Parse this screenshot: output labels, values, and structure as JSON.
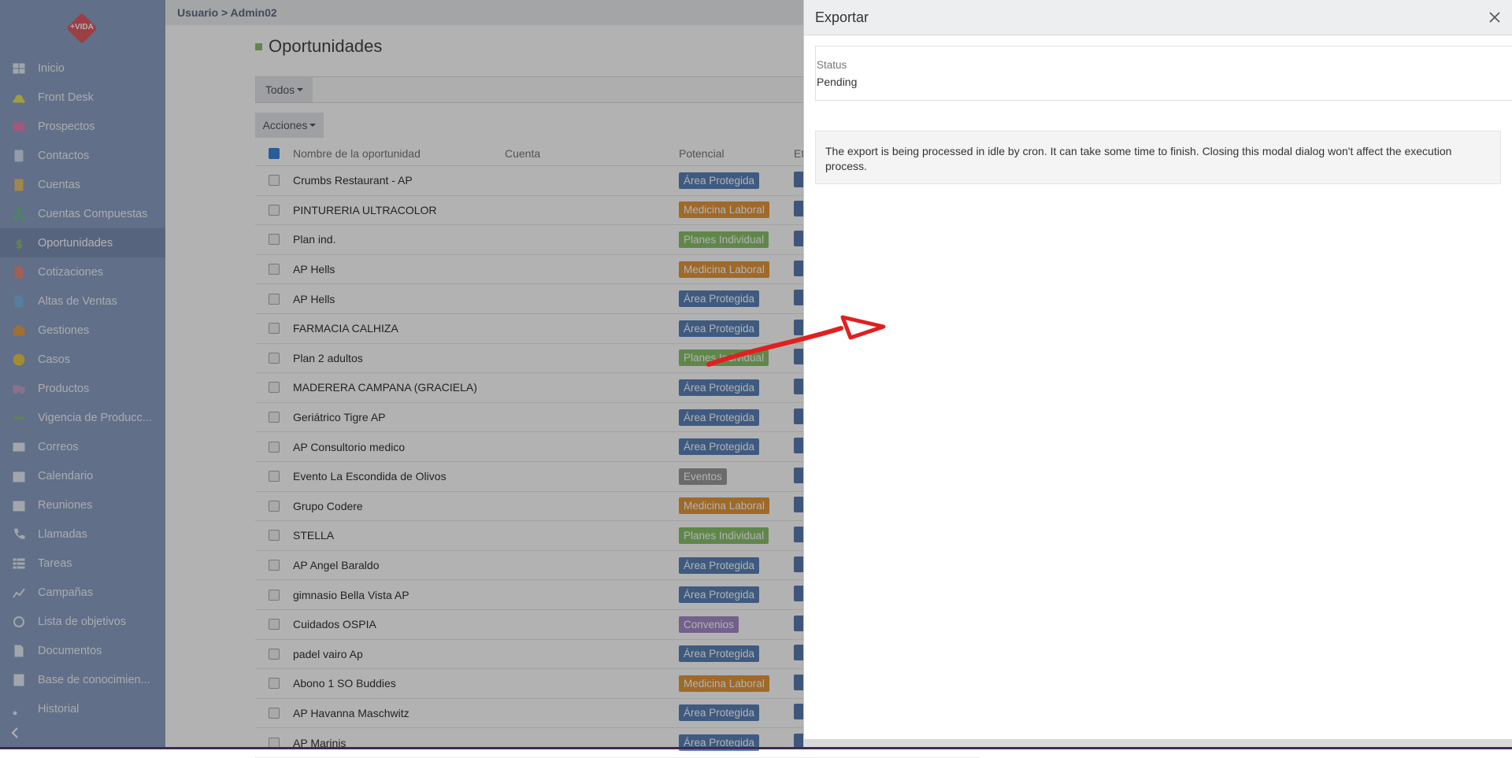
{
  "sidebar": {
    "logo_text": "+VIDA",
    "items": [
      {
        "label": "Inicio",
        "icon": "dashboard-icon",
        "color": "#e9eef7"
      },
      {
        "label": "Front Desk",
        "icon": "bell-icon",
        "color": "#e8e35a"
      },
      {
        "label": "Prospectos",
        "icon": "id-card-icon",
        "color": "#e87fb0"
      },
      {
        "label": "Contactos",
        "icon": "contact-icon",
        "color": "#d6def0"
      },
      {
        "label": "Cuentas",
        "icon": "building-icon",
        "color": "#e6c26a"
      },
      {
        "label": "Cuentas Compuestas",
        "icon": "sitemap-icon",
        "color": "#67c38c"
      },
      {
        "label": "Oportunidades",
        "icon": "dollar-icon",
        "color": "#8ac26b"
      },
      {
        "label": "Cotizaciones",
        "icon": "file-icon",
        "color": "#e88a7a"
      },
      {
        "label": "Altas de Ventas",
        "icon": "document-icon",
        "color": "#7ab7e8"
      },
      {
        "label": "Gestiones",
        "icon": "briefcase-icon",
        "color": "#e6a04a"
      },
      {
        "label": "Casos",
        "icon": "warning-icon",
        "color": "#e8c84a"
      },
      {
        "label": "Productos",
        "icon": "truck-icon",
        "color": "#c8a4c8"
      },
      {
        "label": "Vigencia de Producc...",
        "icon": "arrows-icon",
        "color": "#8ac26b"
      },
      {
        "label": "Correos",
        "icon": "envelope-icon",
        "color": "#e9eef7"
      },
      {
        "label": "Calendario",
        "icon": "calendar-icon",
        "color": "#e9eef7"
      },
      {
        "label": "Reuniones",
        "icon": "calendar-check-icon",
        "color": "#e9eef7"
      },
      {
        "label": "Llamadas",
        "icon": "phone-icon",
        "color": "#e9eef7"
      },
      {
        "label": "Tareas",
        "icon": "list-icon",
        "color": "#e9eef7"
      },
      {
        "label": "Campañas",
        "icon": "chart-icon",
        "color": "#e9eef7"
      },
      {
        "label": "Lista de objetivos",
        "icon": "crosshair-icon",
        "color": "#e9eef7"
      },
      {
        "label": "Documentos",
        "icon": "document-icon",
        "color": "#e9eef7"
      },
      {
        "label": "Base de conocimien...",
        "icon": "book-icon",
        "color": "#e9eef7"
      },
      {
        "label": "Historial",
        "icon": "rss-icon",
        "color": "#e9eef7"
      }
    ],
    "active_index": 6
  },
  "breadcrumb": "Usuario > Admin02",
  "page": {
    "title": "Oportunidades",
    "filter_label": "Todos",
    "actions_label": "Acciones"
  },
  "table": {
    "headers": [
      "Nombre de la oportunidad",
      "Cuenta",
      "Potencial",
      "Et"
    ],
    "rows": [
      {
        "name": "Crumbs Restaurant - AP",
        "tag": "Área Protegida",
        "tag_color": "#5b82b8"
      },
      {
        "name": "PINTURERIA ULTRACOLOR",
        "tag": "Medicina Laboral",
        "tag_color": "#e4973a"
      },
      {
        "name": "Plan ind.",
        "tag": "Planes Individual",
        "tag_color": "#8ac26b"
      },
      {
        "name": "AP Hells",
        "tag": "Medicina Laboral",
        "tag_color": "#e4973a"
      },
      {
        "name": "AP Hells",
        "tag": "Área Protegida",
        "tag_color": "#5b82b8"
      },
      {
        "name": "FARMACIA CALHIZA",
        "tag": "Área Protegida",
        "tag_color": "#5b82b8"
      },
      {
        "name": "Plan 2 adultos",
        "tag": "Planes Individual",
        "tag_color": "#8ac26b"
      },
      {
        "name": "MADERERA CAMPANA (GRACIELA)",
        "tag": "Área Protegida",
        "tag_color": "#5b82b8"
      },
      {
        "name": "Geriátrico Tigre AP",
        "tag": "Área Protegida",
        "tag_color": "#5b82b8"
      },
      {
        "name": "AP Consultorio medico",
        "tag": "Área Protegida",
        "tag_color": "#5b82b8"
      },
      {
        "name": "Evento La Escondida de Olivos",
        "tag": "Eventos",
        "tag_color": "#9a9a9a"
      },
      {
        "name": "Grupo Codere",
        "tag": "Medicina Laboral",
        "tag_color": "#e4973a"
      },
      {
        "name": "STELLA",
        "tag": "Planes Individual",
        "tag_color": "#8ac26b"
      },
      {
        "name": "AP Angel Baraldo",
        "tag": "Área Protegida",
        "tag_color": "#5b82b8"
      },
      {
        "name": "gimnasio Bella Vista AP",
        "tag": "Área Protegida",
        "tag_color": "#5b82b8"
      },
      {
        "name": "Cuidados OSPIA",
        "tag": "Convenios",
        "tag_color": "#a58ac9"
      },
      {
        "name": "padel vairo Ap",
        "tag": "Área Protegida",
        "tag_color": "#5b82b8"
      },
      {
        "name": "Abono 1 SO Buddies",
        "tag": "Medicina Laboral",
        "tag_color": "#e4973a"
      },
      {
        "name": "AP Havanna Maschwitz",
        "tag": "Área Protegida",
        "tag_color": "#5b82b8"
      },
      {
        "name": "AP Marinis",
        "tag": "Área Protegida",
        "tag_color": "#5b82b8"
      }
    ]
  },
  "modal": {
    "title": "Exportar",
    "status_label": "Status",
    "status_value": "Pending",
    "notice": "The export is being processed in idle by cron. It can take some time to finish. Closing this modal dialog won't affect the execution process."
  }
}
